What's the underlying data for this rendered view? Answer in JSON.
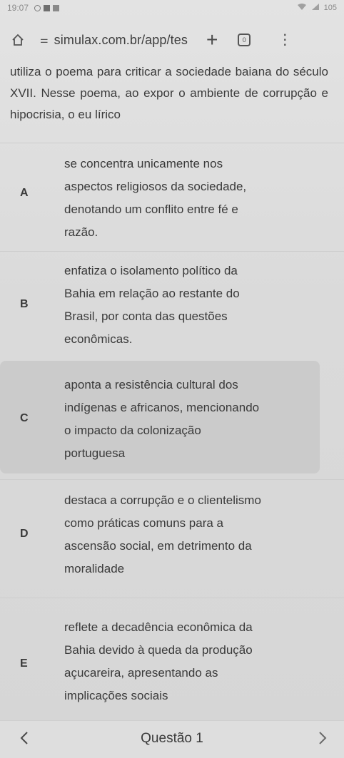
{
  "status_bar": {
    "time": "19:07",
    "battery": "105"
  },
  "browser": {
    "url": "simulax.com.br/app/tes",
    "tabs_count": "0"
  },
  "question": {
    "text": "utiliza o poema para criticar a sociedade baiana do século XVII. Nesse poema, ao expor o ambiente de corrupção e hipocrisia, o eu lírico"
  },
  "options": [
    {
      "letter": "A",
      "lines": [
        "se concentra unicamente nos",
        "aspectos religiosos da sociedade,",
        "denotando um conflito entre fé e",
        "razão."
      ]
    },
    {
      "letter": "B",
      "lines": [
        "enfatiza o isolamento político da",
        "Bahia em relação ao restante do",
        "Brasil, por conta das questões",
        "econômicas."
      ]
    },
    {
      "letter": "C",
      "lines": [
        "aponta a resistência cultural dos",
        "indígenas e africanos, mencionando",
        "o impacto da colonização",
        "portuguesa"
      ],
      "selected": true
    },
    {
      "letter": "D",
      "lines": [
        "destaca a corrupção e o clientelismo",
        "como práticas comuns para a",
        "ascensão social, em detrimento da",
        "moralidade"
      ]
    },
    {
      "letter": "E",
      "lines": [
        "reflete a decadência econômica da",
        "Bahia devido à queda da produção",
        "açucareira, apresentando as",
        "implicações sociais"
      ]
    }
  ],
  "bottom_nav": {
    "question_label": "Questão 1"
  },
  "icons": {
    "prev": "chevron-left-icon",
    "next": "chevron-right-icon",
    "home": "home-icon",
    "menu": "more-vert-icon"
  }
}
